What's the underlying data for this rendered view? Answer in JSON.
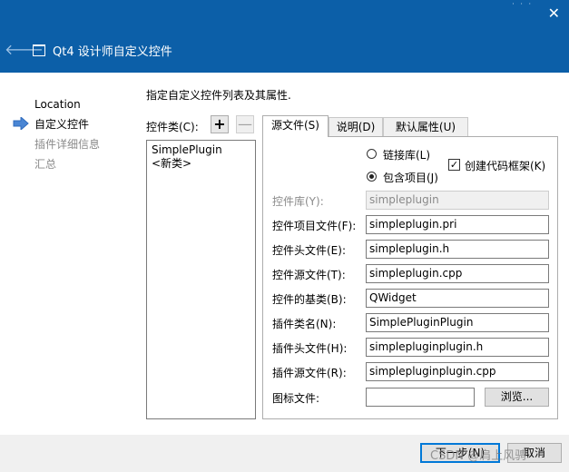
{
  "window": {
    "title": "Qt4 设计师自定义控件"
  },
  "nav": {
    "items": [
      "Location",
      "自定义控件",
      "插件详细信息",
      "汇总"
    ],
    "current_index": 1
  },
  "page": {
    "description": "指定自定义控件列表及其属性."
  },
  "classes": {
    "label": "控件类(C):",
    "add": "+",
    "remove": "—",
    "items": [
      "SimplePlugin",
      "<新类>"
    ]
  },
  "tabs": [
    "源文件(S)",
    "说明(D)",
    "默认属性(U)"
  ],
  "options": {
    "link_library": "链接库(L)",
    "include_project": "包含项目(J)",
    "create_skeleton": "创建代码框架(K)"
  },
  "fields": {
    "library": {
      "label": "控件库(Y):",
      "value": "simpleplugin"
    },
    "project_file": {
      "label": "控件项目文件(F):",
      "value": "simpleplugin.pri"
    },
    "header_file": {
      "label": "控件头文件(E):",
      "value": "simpleplugin.h"
    },
    "source_file": {
      "label": "控件源文件(T):",
      "value": "simpleplugin.cpp"
    },
    "base_class": {
      "label": "控件的基类(B):",
      "value": "QWidget"
    },
    "plugin_class": {
      "label": "插件类名(N):",
      "value": "SimplePluginPlugin"
    },
    "plugin_header": {
      "label": "插件头文件(H):",
      "value": "simplepluginplugin.h"
    },
    "plugin_source": {
      "label": "插件源文件(R):",
      "value": "simplepluginplugin.cpp"
    },
    "icon_file": {
      "label": "图标文件:",
      "value": ""
    }
  },
  "browse_label": "浏览...",
  "footer": {
    "next_label": "下一步(N)",
    "cancel_label": "取消"
  },
  "watermark": "CSDN @肩上风骋",
  "colors": {
    "title_bar": "#0c5fa8",
    "nav_arrow": "#4a86d4",
    "default_button_border": "#0078d7"
  }
}
